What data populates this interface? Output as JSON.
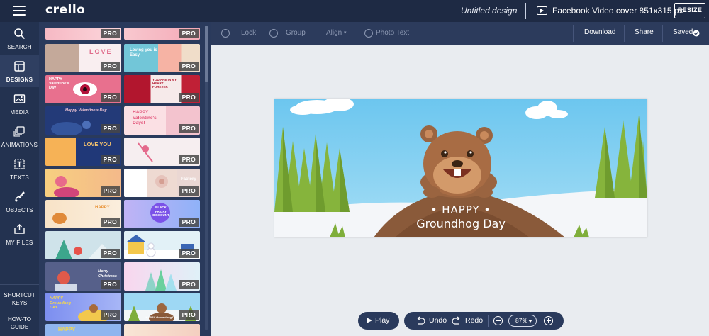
{
  "app": {
    "logo": "crello",
    "document_title": "Untitled design",
    "format": "Facebook Video cover 851x315 px",
    "resize_label": "RESIZE"
  },
  "nav": {
    "items": [
      {
        "label": "SEARCH",
        "icon": "search-icon"
      },
      {
        "label": "DESIGNS",
        "icon": "designs-icon",
        "active": true
      },
      {
        "label": "MEDIA",
        "icon": "media-icon"
      },
      {
        "label": "ANIMATIONS",
        "icon": "animations-icon"
      },
      {
        "label": "TEXTS",
        "icon": "texts-icon"
      },
      {
        "label": "OBJECTS",
        "icon": "objects-icon"
      },
      {
        "label": "MY FILES",
        "icon": "my-files-icon"
      }
    ],
    "shortcut_keys": "SHORTCUT KEYS",
    "how_to_guide": "HOW-TO GUIDE"
  },
  "templates": {
    "badge": "PRO",
    "items": [
      {
        "text": ""
      },
      {
        "text": ""
      },
      {
        "text": "LOVE"
      },
      {
        "text": "Loving you is Easy"
      },
      {
        "text": "HAPPY Valentine's Day"
      },
      {
        "text": "YOU ARE IN MY HEART FOREVER"
      },
      {
        "text": "Happy Valentine's Day"
      },
      {
        "text": "HAPPY Valentine's Days!"
      },
      {
        "text": "LOVE YOU"
      },
      {
        "text": ""
      },
      {
        "text": ""
      },
      {
        "text": "Factory"
      },
      {
        "text": "HAPPY"
      },
      {
        "text": "BLACK FRIDAY DISCOUNT"
      },
      {
        "text": ""
      },
      {
        "text": ""
      },
      {
        "text": "Merry Christmas"
      },
      {
        "text": ""
      },
      {
        "text": "HAPPY Groundhog DAY"
      },
      {
        "text": "HAPPY Groundhog Day"
      },
      {
        "text": "HAPPY"
      },
      {
        "text": ""
      }
    ]
  },
  "toolbar": {
    "lock": "Lock",
    "group": "Group",
    "align": "Align",
    "photo_text": "Photo Text",
    "download": "Download",
    "share": "Share",
    "saved": "Saved"
  },
  "design": {
    "line1": "• HAPPY •",
    "line2": "Groundhog Day"
  },
  "bottom": {
    "play": "Play",
    "undo": "Undo",
    "redo": "Redo",
    "zoom": "87%"
  },
  "colors": {
    "topbar": "#1e2a44",
    "sidebar": "#233250",
    "panel": "#2a3a5c",
    "sky": "#7fd0f2",
    "tree": "#86b43c",
    "ground": "#8a5a3a"
  }
}
